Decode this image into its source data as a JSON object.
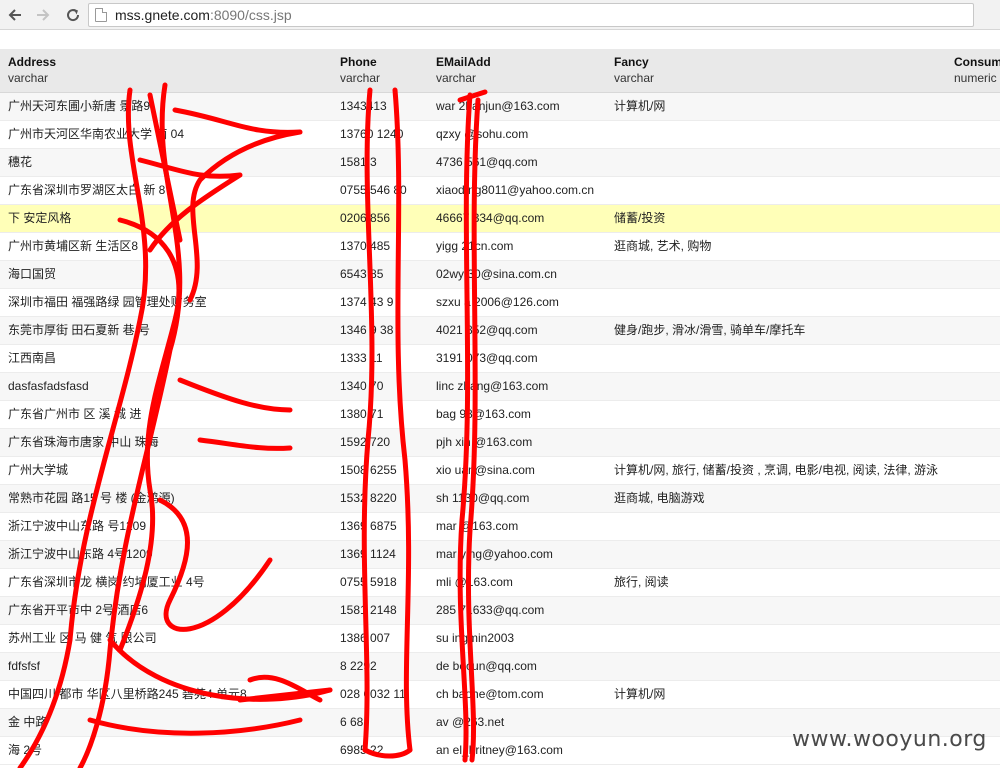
{
  "browser": {
    "url_host": "mss.gnete.com",
    "url_rest": ":8090/css.jsp",
    "back_icon": "arrow-left-icon",
    "forward_icon": "arrow-right-icon",
    "reload_icon": "reload-icon"
  },
  "table": {
    "columns": [
      {
        "name": "Address",
        "type": "varchar"
      },
      {
        "name": "Phone",
        "type": "varchar"
      },
      {
        "name": "EMailAdd",
        "type": "varchar"
      },
      {
        "name": "Fancy",
        "type": "varchar"
      },
      {
        "name": "Consum",
        "type": "numeric"
      }
    ],
    "rows": [
      {
        "address": "广州天河东圃小新唐 景路9",
        "phone": "1343413",
        "email": "war 2banjun@163.com",
        "fancy": "计算机/网"
      },
      {
        "address": "广州市天河区华南农业大学 南 04",
        "phone": "13760 1240",
        "email": "qzxy @sohu.com",
        "fancy": ""
      },
      {
        "address": "穗花",
        "phone": "1581 3",
        "email": "4736 561@qq.com",
        "fancy": ""
      },
      {
        "address": "广东省深圳市罗湖区太白 新 8",
        "phone": "0755 546 80",
        "email": "xiaod ng8011@yahoo.com.cn",
        "fancy": ""
      },
      {
        "address": "下 安定风格",
        "phone": "0206 856",
        "email": "46667 334@qq.com",
        "fancy": "储蓄/投资"
      },
      {
        "address": "广州市黄埔区新 生活区8",
        "phone": "1370 485",
        "email": "yigg 21cn.com",
        "fancy": "逛商城, 艺术, 购物"
      },
      {
        "address": "海口国贸",
        "phone": "6543 85",
        "email": "02wy 30@sina.com.cn",
        "fancy": ""
      },
      {
        "address": "深圳市福田 福强路绿 园管理处财务室",
        "phone": "1374 43 9",
        "email": "szxu a 2006@126.com",
        "fancy": ""
      },
      {
        "address": "东莞市厚街 田石夏新 巷 号",
        "phone": "1346 9 38",
        "email": "4021 852@qq.com",
        "fancy": "健身/跑步, 滑冰/滑雪, 骑单车/摩托车"
      },
      {
        "address": "江西南昌",
        "phone": "1333 11",
        "email": "3191 073@qq.com",
        "fancy": ""
      },
      {
        "address": "dasfasfadsfasd",
        "phone": "1340 70",
        "email": "linc zhang@163.com",
        "fancy": ""
      },
      {
        "address": "广东省广州市 区 溪 城 进",
        "phone": "1380 71",
        "email": "bag 98@163.com",
        "fancy": ""
      },
      {
        "address": "广东省珠海市唐家 中山 珠海",
        "phone": "1592 720",
        "email": "pjh xin @163.com",
        "fancy": ""
      },
      {
        "address": "广州大学城",
        "phone": "1508 6255",
        "email": "xio uan@sina.com",
        "fancy": "计算机/网, 旅行, 储蓄/投资 , 烹调, 电影/电视, 阅读, 法律, 游泳"
      },
      {
        "address": "常熟市花园 路15 号 楼 (金鸿源)",
        "phone": "1532 8220",
        "email": "sh 1130@qq.com",
        "fancy": "逛商城, 电脑游戏"
      },
      {
        "address": "浙江宁波中山东路 号1209",
        "phone": "1369 6875",
        "email": "mar @163.com",
        "fancy": ""
      },
      {
        "address": "浙江宁波中山东路 4号1209",
        "phone": "1369 1124",
        "email": "mar ying@yahoo.com",
        "fancy": ""
      },
      {
        "address": "广东省深圳市龙 横岗 约埔厦工业 4号",
        "phone": "0755 5918",
        "email": "mli @163.com",
        "fancy": "旅行, 阅读"
      },
      {
        "address": "广东省开平市中 2号 酒店6",
        "phone": "1581 2148",
        "email": "285 71633@qq.com",
        "fancy": ""
      },
      {
        "address": "苏州工业 区 马 健 气 限公司",
        "phone": "1386 007",
        "email": "su ingmin2003",
        "fancy": ""
      },
      {
        "address": "fdfsfsf",
        "phone": "8 2292",
        "email": "de bocun@qq.com",
        "fancy": ""
      },
      {
        "address": "中国四川 都市 华区八里桥路245 碧苑4 单元8",
        "phone": "028 6032 11",
        "email": "ch baohe@tom.com",
        "fancy": "计算机/网"
      },
      {
        "address": "金 中路",
        "phone": "6 68",
        "email": "av @263.net",
        "fancy": ""
      },
      {
        "address": "海 2号",
        "phone": "6985 22",
        "email": "an el_britney@163.com",
        "fancy": ""
      }
    ]
  },
  "watermark": "www.wooyun.org",
  "colors": {
    "scribble": "#ff0000",
    "highlight_row": "#ffffb8",
    "header_bg": "#e9e9e9"
  }
}
